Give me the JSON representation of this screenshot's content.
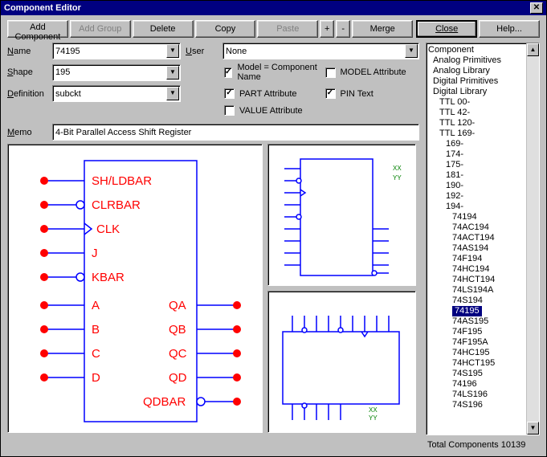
{
  "title": "Component Editor",
  "toolbar": {
    "add_component": "Add Component",
    "add_group": "Add Group",
    "delete": "Delete",
    "copy": "Copy",
    "paste": "Paste",
    "plus": "+",
    "minus": "-",
    "merge": "Merge",
    "close": "Close",
    "help": "Help..."
  },
  "labels": {
    "name": "Name",
    "shape": "Shape",
    "definition": "Definition",
    "user": "User",
    "memo": "Memo"
  },
  "fields": {
    "name": "74195",
    "shape": "195",
    "definition": "subckt",
    "user": "None"
  },
  "checks": {
    "model_eq": "Model = Component Name",
    "model_attr": "MODEL Attribute",
    "part_attr": "PART Attribute",
    "pin_text": "PIN Text",
    "value_attr": "VALUE Attribute"
  },
  "memo": "4-Bit Parallel Access Shift Register",
  "pins": {
    "p1": "SH/LDBAR",
    "p2": "CLRBAR",
    "p3": "CLK",
    "p4": "J",
    "p5": "KBAR",
    "p6": "A",
    "p7": "B",
    "p8": "C",
    "p9": "D",
    "q1": "QA",
    "q2": "QB",
    "q3": "QC",
    "q4": "QD",
    "q5": "QDBAR"
  },
  "mini": {
    "xx": "XX",
    "yy": "YY"
  },
  "tree": {
    "root": "Component",
    "t1": "Analog Primitives",
    "t2": "Analog Library",
    "t3": "Digital Primitives",
    "t4": "Digital Library",
    "l1": "TTL 00-",
    "l2": "TTL 42-",
    "l3": "TTL 120-",
    "l4": "TTL 169-",
    "s1": "169-",
    "s2": "174-",
    "s3": "175-",
    "s4": "181-",
    "s5": "190-",
    "s6": "192-",
    "s7": "194-",
    "items": [
      "74194",
      "74AC194",
      "74ACT194",
      "74AS194",
      "74F194",
      "74HC194",
      "74HCT194",
      "74LS194A",
      "74S194",
      "74195",
      "74AS195",
      "74F195",
      "74F195A",
      "74HC195",
      "74HCT195",
      "74S195",
      "74196",
      "74LS196",
      "74S196"
    ]
  },
  "total": "Total Components 10139"
}
